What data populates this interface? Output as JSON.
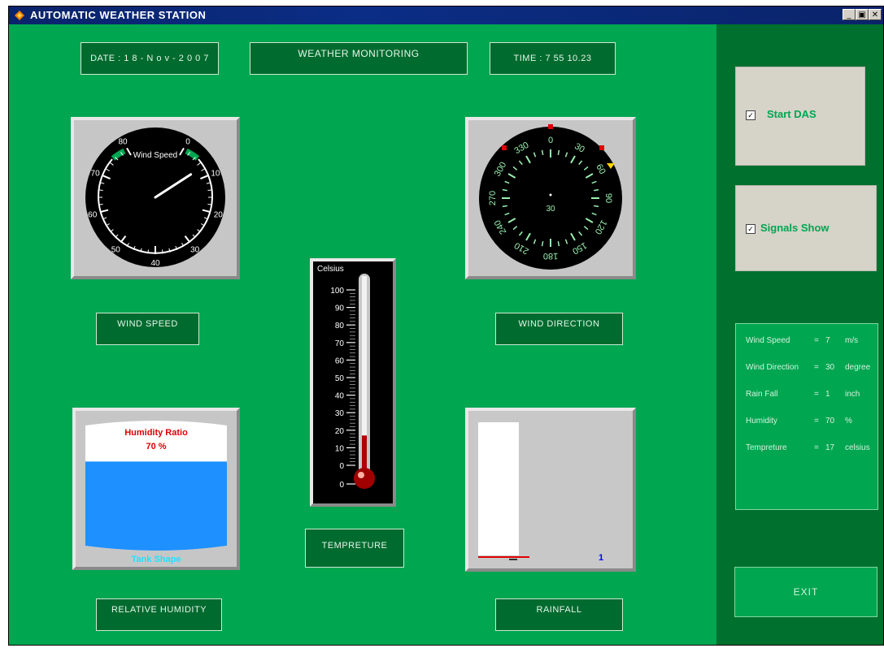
{
  "window": {
    "title": "AUTOMATIC WEATHER STATION",
    "minimize_glyph": "_",
    "maximize_glyph": "▣",
    "close_glyph": "✕"
  },
  "header": {
    "date_text": "DATE : 1 8 - N o v - 2 0 0 7",
    "main_title": "WEATHER MONITORING",
    "time_text": "TIME :  7  55  10.23"
  },
  "wind_speed_gauge": {
    "title": "Wind Speed",
    "ticks": [
      "0",
      "10",
      "20",
      "30",
      "40",
      "50",
      "60",
      "70",
      "80"
    ],
    "value": 7,
    "label": "WIND SPEED"
  },
  "wind_direction_gauge": {
    "center_value": "30",
    "ticks": [
      "0",
      "30",
      "60",
      "90",
      "120",
      "150",
      "180",
      "210",
      "240",
      "270",
      "300",
      "330"
    ],
    "label": "WIND DIRECTION"
  },
  "thermometer": {
    "unit": "Celsius",
    "ticks": [
      "100",
      "90",
      "80",
      "70",
      "60",
      "50",
      "40",
      "30",
      "20",
      "10",
      "0",
      "0"
    ],
    "value": 17,
    "label": "TEMPRETURE"
  },
  "humidity_tank": {
    "title": "Humidity Ratio",
    "value_text": "70 %",
    "value": 70,
    "shape_label": "Tank Shape",
    "label": "RELATIVE HUMIDITY"
  },
  "rainfall_bar": {
    "value_text": "1",
    "label": "RAINFALL"
  },
  "controls": {
    "start_das_label": "Start DAS",
    "start_das_checked": true,
    "signals_show_label": "Signals Show",
    "signals_show_checked": true,
    "exit_label": "EXIT"
  },
  "readouts": [
    {
      "name": "Wind Speed",
      "eq": "=",
      "value": "7",
      "unit": "m/s"
    },
    {
      "name": "Wind Direction",
      "eq": "=",
      "value": "30",
      "unit": "degree"
    },
    {
      "name": "Rain Fall",
      "eq": "=",
      "value": "1",
      "unit": "inch"
    },
    {
      "name": "Humidity",
      "eq": "=",
      "value": "70",
      "unit": "%"
    },
    {
      "name": "Tempreture",
      "eq": "=",
      "value": "17",
      "unit": "celsius"
    }
  ],
  "colors": {
    "background": "#00a650",
    "dark_green": "#006b2e",
    "panel_grey": "#c6c6c6",
    "water_blue": "#1e90ff",
    "red": "#e00000"
  }
}
